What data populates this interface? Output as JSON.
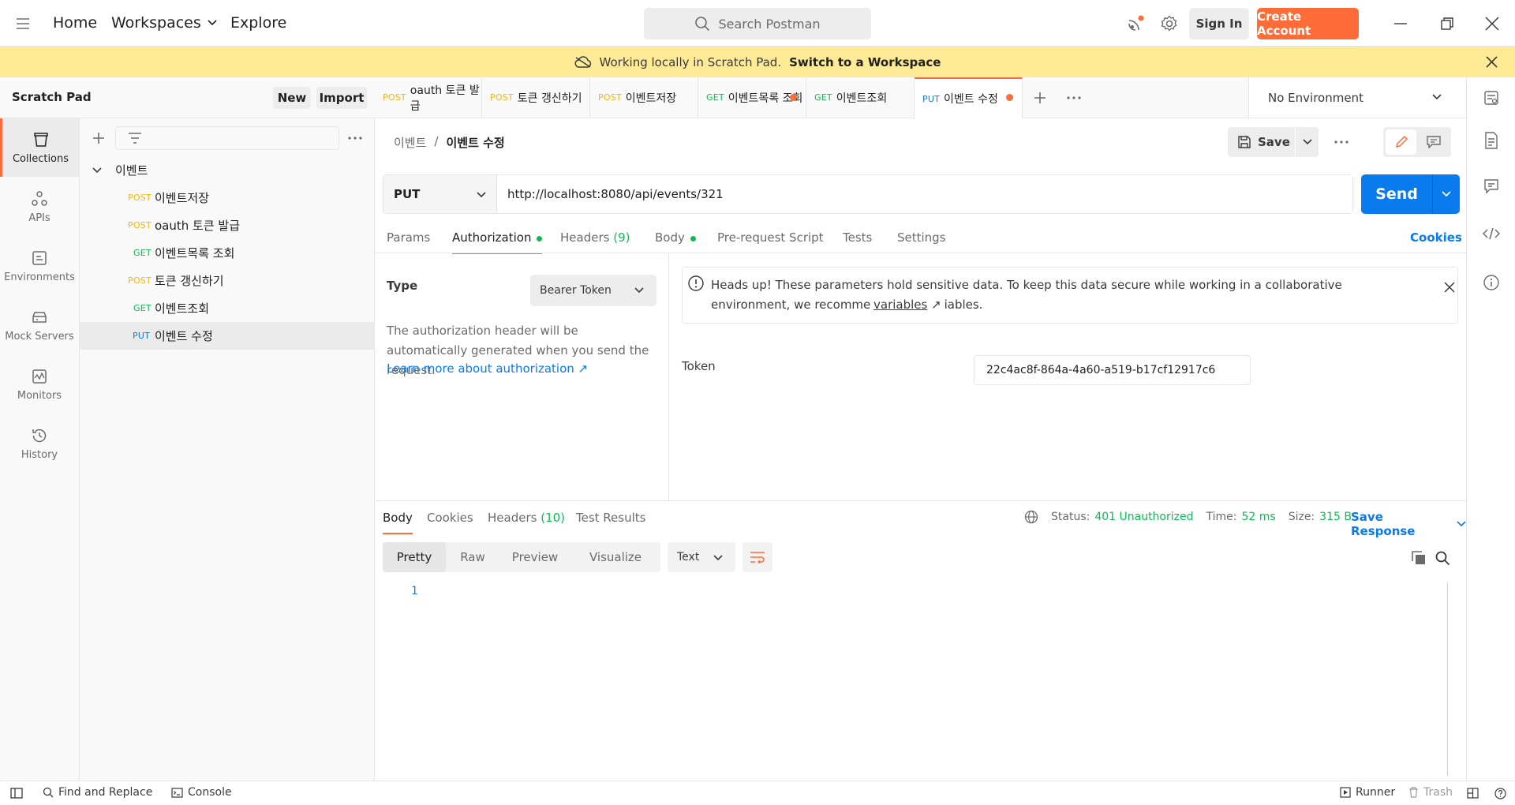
{
  "topbar": {
    "home": "Home",
    "workspaces": "Workspaces",
    "explore": "Explore",
    "search_placeholder": "Search Postman",
    "sign_in": "Sign In",
    "create_account": "Create Account"
  },
  "banner": {
    "text": "Working locally in Scratch Pad.",
    "link": "Switch to a Workspace"
  },
  "rail": [
    {
      "label": "Collections",
      "icon": "collections-icon"
    },
    {
      "label": "APIs",
      "icon": "apis-icon"
    },
    {
      "label": "Environments",
      "icon": "environments-icon"
    },
    {
      "label": "Mock Servers",
      "icon": "mock-servers-icon"
    },
    {
      "label": "Monitors",
      "icon": "monitors-icon"
    },
    {
      "label": "History",
      "icon": "history-icon"
    }
  ],
  "sidebar": {
    "title": "Scratch Pad",
    "new": "New",
    "import": "Import",
    "folder": "이벤트",
    "items": [
      {
        "method": "POST",
        "name": "이벤트저장"
      },
      {
        "method": "POST",
        "name": "oauth 토큰 발급"
      },
      {
        "method": "GET",
        "name": "이벤트목록 조회"
      },
      {
        "method": "POST",
        "name": "토큰 갱신하기"
      },
      {
        "method": "GET",
        "name": "이벤트조회"
      },
      {
        "method": "PUT",
        "name": "이벤트 수정"
      }
    ]
  },
  "tabs": [
    {
      "method": "POST",
      "name": "oauth 토큰 발급"
    },
    {
      "method": "POST",
      "name": "토큰 갱신하기"
    },
    {
      "method": "POST",
      "name": "이벤트저장"
    },
    {
      "method": "GET",
      "name": "이벤트목록 조회"
    },
    {
      "method": "GET",
      "name": "이벤트조회"
    },
    {
      "method": "PUT",
      "name": "이벤트 수정"
    }
  ],
  "environment": "No Environment",
  "request": {
    "breadcrumb_parent": "이벤트",
    "breadcrumb_sep": "/",
    "breadcrumb_current": "이벤트 수정",
    "save": "Save",
    "method": "PUT",
    "url": "http://localhost:8080/api/events/321",
    "send": "Send",
    "subtabs": {
      "params": "Params",
      "authorization": "Authorization",
      "headers": "Headers",
      "headers_count": "(9)",
      "body": "Body",
      "pre_request": "Pre-request Script",
      "tests": "Tests",
      "settings": "Settings"
    },
    "cookies": "Cookies"
  },
  "auth": {
    "type_label": "Type",
    "type_value": "Bearer Token",
    "description": "The authorization header will be automatically generated when you send the request.",
    "learn_more": "Learn more about authorization ↗",
    "headsup": "Heads up! These parameters hold sensitive data. To keep this data secure while working in a collaborative environment, we recommend using variables.",
    "variables_link": "variables",
    "token_label": "Token",
    "token_value": "22c4ac8f-864a-4a60-a519-b17cf12917c6"
  },
  "response": {
    "tabs": {
      "body": "Body",
      "cookies": "Cookies",
      "headers": "Headers",
      "headers_count": "(10)",
      "test_results": "Test Results"
    },
    "status_label": "Status:",
    "status_value": "401 Unauthorized",
    "time_label": "Time:",
    "time_value": "52 ms",
    "size_label": "Size:",
    "size_value": "315 B",
    "save_response": "Save Response",
    "views": [
      "Pretty",
      "Raw",
      "Preview",
      "Visualize"
    ],
    "format": "Text",
    "line_number": "1"
  },
  "statusbar": {
    "find_replace": "Find and Replace",
    "console": "Console",
    "runner": "Runner",
    "trash": "Trash"
  },
  "colors": {
    "accent": "#ff6c37",
    "primary": "#097bed",
    "post": "#ffb400",
    "get": "#0cbb52",
    "put": "#097bed",
    "banner": "#ffeb96"
  }
}
